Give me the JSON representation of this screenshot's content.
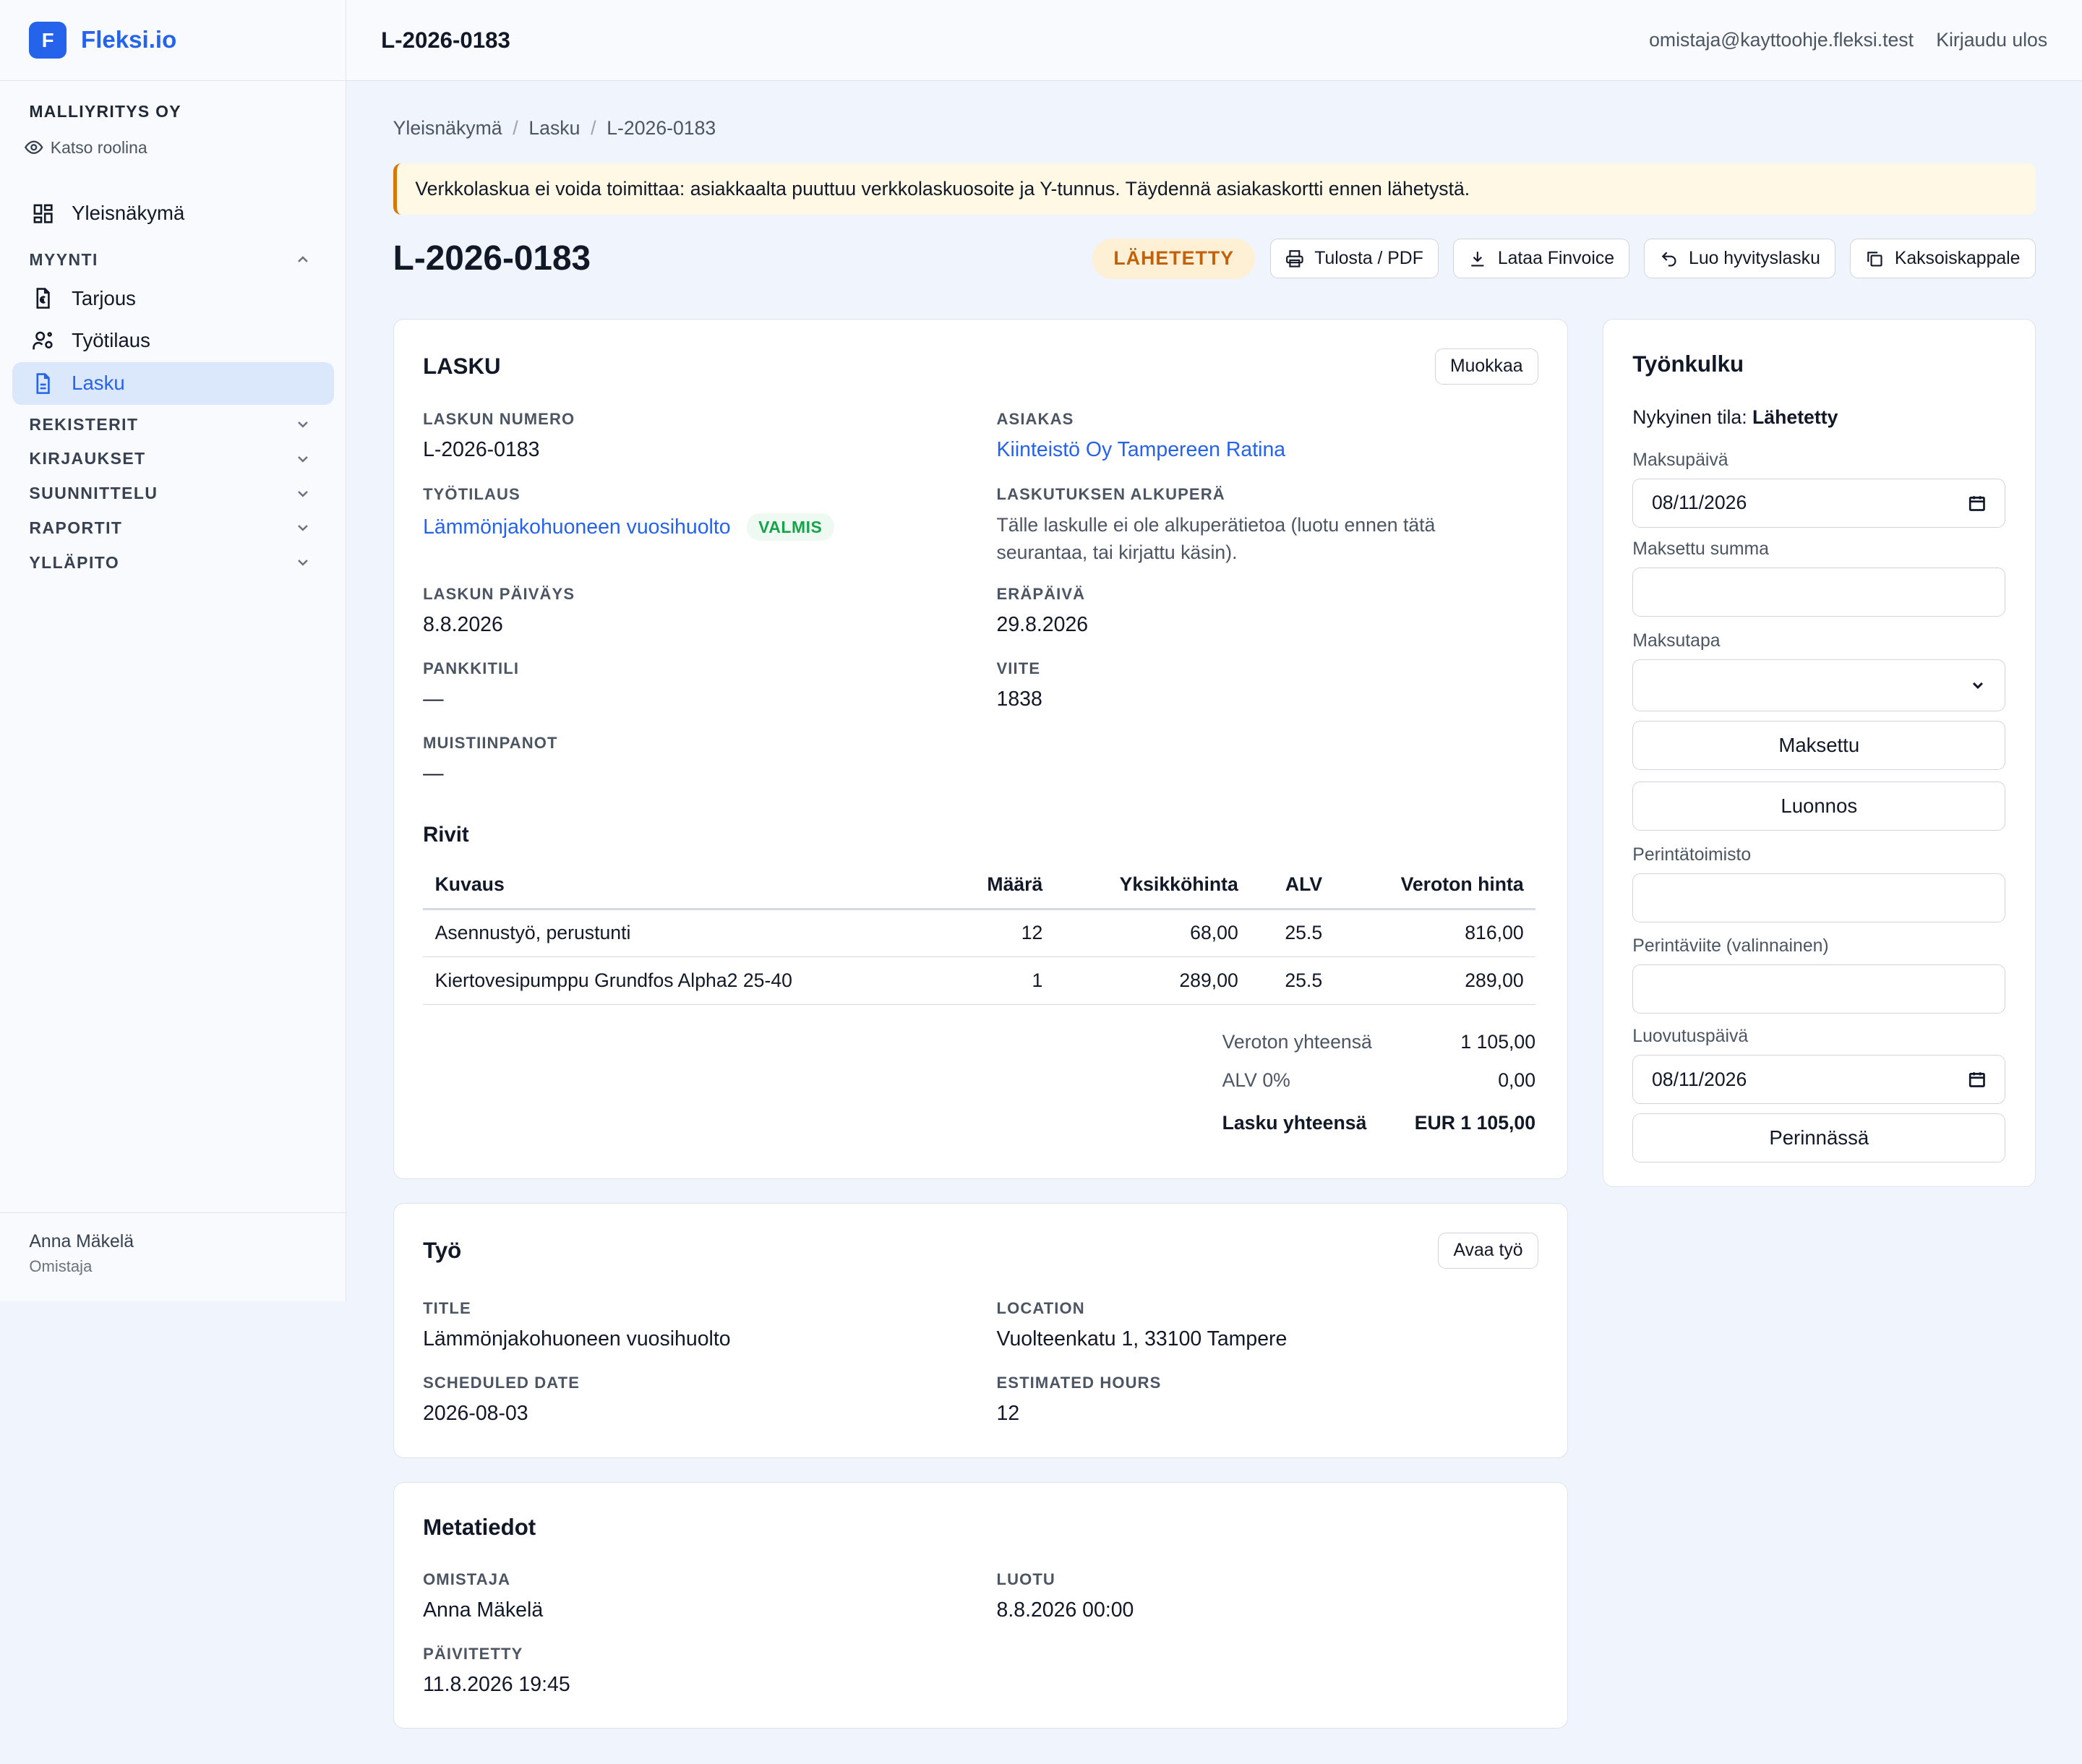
{
  "app": {
    "logo_letter": "F",
    "name": "Fleksi.io"
  },
  "sidebar": {
    "company": "MALLIYRITYS OY",
    "view_role": "Katso roolina",
    "overview": "Yleisnäkymä",
    "sales_section": "MYYNTI",
    "sales_items": [
      "Tarjous",
      "Työtilaus",
      "Lasku"
    ],
    "sections": [
      "REKISTERIT",
      "KIRJAUKSET",
      "SUUNNITTELU",
      "RAPORTIT",
      "YLLÄPITO"
    ],
    "user_name": "Anna Mäkelä",
    "user_role": "Omistaja"
  },
  "topbar": {
    "title": "L-2026-0183",
    "email": "omistaja@kayttoohje.fleksi.test",
    "logout": "Kirjaudu ulos"
  },
  "breadcrumb": [
    "Yleisnäkymä",
    "Lasku",
    "L-2026-0183"
  ],
  "alert": "Verkkolaskua ei voida toimittaa: asiakkaalta puuttuu verkkolaskuosoite ja Y-tunnus. Täydennä asiakaskortti ennen lähetystä.",
  "page": {
    "title": "L-2026-0183",
    "status": "LÄHETETTY",
    "actions": [
      "Tulosta / PDF",
      "Lataa Finvoice",
      "Luo hyvityslasku",
      "Kaksoiskappale"
    ]
  },
  "invoice": {
    "title": "LASKU",
    "edit": "Muokkaa",
    "number_label": "LASKUN NUMERO",
    "number": "L-2026-0183",
    "customer_label": "ASIAKAS",
    "customer": "Kiinteistö Oy Tampereen Ratina",
    "order_label": "TYÖTILAUS",
    "order": "Lämmönjakohuoneen vuosihuolto",
    "order_status": "VALMIS",
    "origin_label": "LASKUTUKSEN ALKUPERÄ",
    "origin_line1": "Tälle laskulle ei ole alkuperätietoa (luotu ennen tätä",
    "origin_line2": "seurantaa, tai kirjattu käsin).",
    "date_label": "LASKUN PÄIVÄYS",
    "date": "8.8.2026",
    "due_label": "ERÄPÄIVÄ",
    "due": "29.8.2026",
    "bank_label": "PANKKITILI",
    "bank": "—",
    "ref_label": "VIITE",
    "ref": "1838",
    "notes_label": "MUISTIINPANOT",
    "notes": "—",
    "rows_title": "Rivit",
    "columns": [
      "Kuvaus",
      "Määrä",
      "Yksikköhinta",
      "ALV",
      "Veroton hinta"
    ],
    "rows": [
      [
        "Asennustyö, perustunti",
        "12",
        "68,00",
        "25.5",
        "816,00"
      ],
      [
        "Kiertovesipumppu Grundfos Alpha2 25-40",
        "1",
        "289,00",
        "25.5",
        "289,00"
      ]
    ],
    "subtotal_label": "Veroton yhteensä",
    "subtotal": "1 105,00",
    "vat_label": "ALV 0%",
    "vat": "0,00",
    "total_label": "Lasku yhteensä",
    "total": "EUR 1 105,00"
  },
  "work": {
    "title": "Työ",
    "open": "Avaa työ",
    "title_label": "TITLE",
    "title_value": "Lämmönjakohuoneen vuosihuolto",
    "location_label": "LOCATION",
    "location": "Vuolteenkatu 1, 33100 Tampere",
    "date_label": "SCHEDULED DATE",
    "date": "2026-08-03",
    "hours_label": "ESTIMATED HOURS",
    "hours": "12"
  },
  "meta": {
    "title": "Metatiedot",
    "owner_label": "OMISTAJA",
    "owner": "Anna Mäkelä",
    "created_label": "LUOTU",
    "created": "8.8.2026 00:00",
    "updated_label": "PÄIVITETTY",
    "updated": "11.8.2026 19:45"
  },
  "workflow": {
    "title": "Työnkulku",
    "current_prefix": "Nykyinen tila:",
    "current": "Lähetetty",
    "paydate_label": "Maksupäivä",
    "paydate": "08/11/2026",
    "paid_amount_label": "Maksettu summa",
    "paid_amount": "",
    "method_label": "Maksutapa",
    "method": "",
    "paid_button": "Maksettu",
    "draft_button": "Luonnos",
    "collection_label": "Perintätoimisto",
    "collection": "",
    "collection_ref_label": "Perintäviite (valinnainen)",
    "collection_ref": "",
    "handover_label": "Luovutuspäivä",
    "handover": "08/11/2026",
    "collection_button": "Perinnässä"
  }
}
